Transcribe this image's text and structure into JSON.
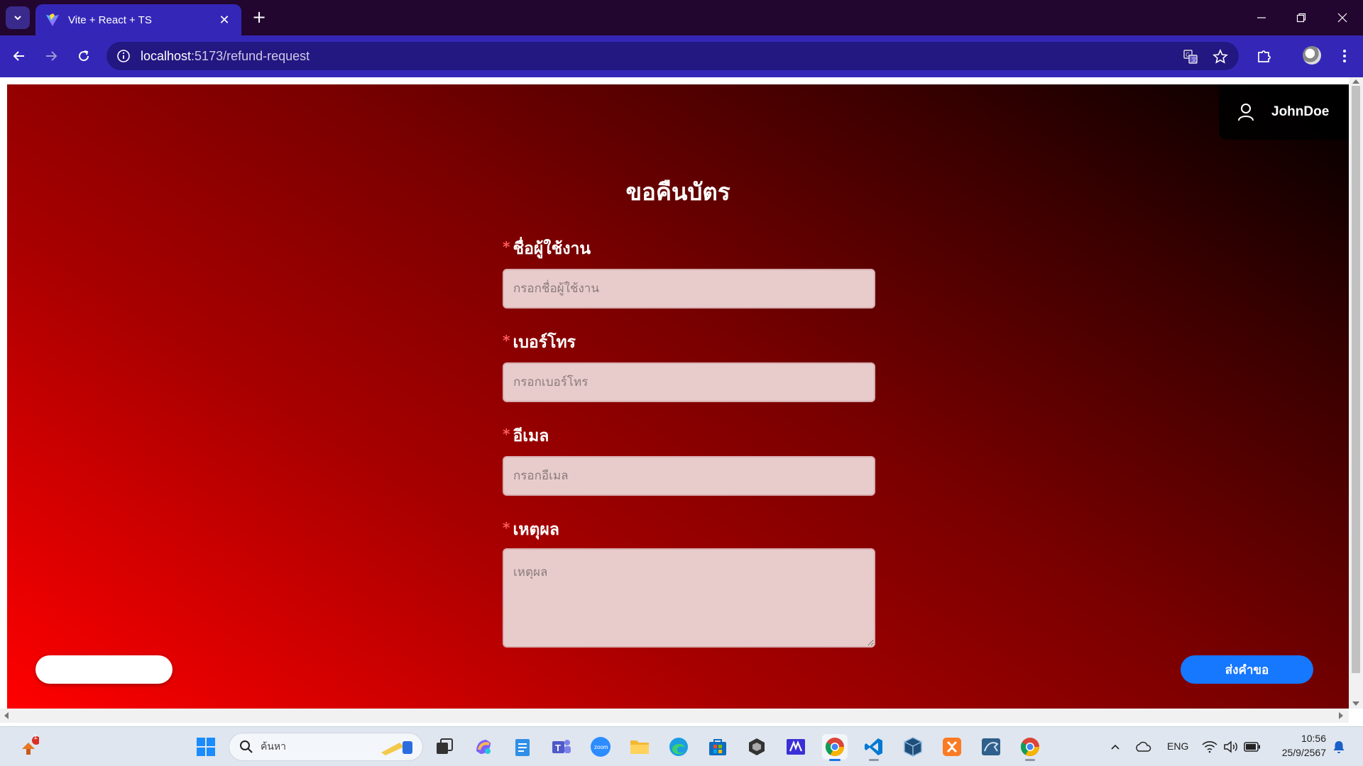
{
  "browser": {
    "tab_title": "Vite + React + TS",
    "url_host": "localhost",
    "url_rest": ":5173/refund-request"
  },
  "page": {
    "username": "JohnDoe",
    "form_title": "ขอคืนบัตร",
    "required_mark": "*",
    "fields": [
      {
        "label": "ชื่อผู้ใช้งาน",
        "placeholder": "กรอกชื่อผู้ใช้งาน"
      },
      {
        "label": "เบอร์โทร",
        "placeholder": "กรอกเบอร์โทร"
      },
      {
        "label": "อีเมล",
        "placeholder": "กรอกอีเมล"
      },
      {
        "label": "เหตุผล",
        "placeholder": "เหตุผล"
      }
    ],
    "back_button_label": "",
    "submit_button_label": "ส่งคำขอ",
    "gradient_colors": [
      "#ff0000",
      "#7a0000",
      "#000000"
    ],
    "submit_color": "#1677ff"
  },
  "taskbar": {
    "search_placeholder": "ค้นหา",
    "notification_badge": "1",
    "language": "ENG",
    "time": "10:56",
    "date": "25/9/2567"
  }
}
